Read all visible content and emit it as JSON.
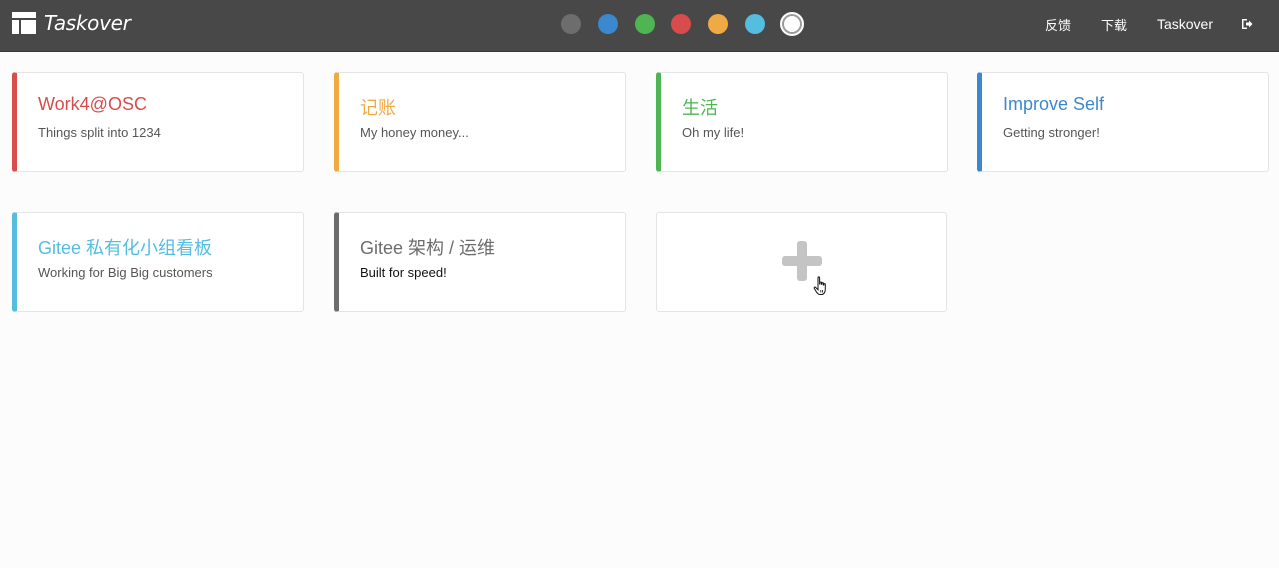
{
  "app": {
    "brand_name": "Taskover",
    "brand_icon": "board-layout-icon"
  },
  "theme_swatches": [
    {
      "name": "gray",
      "color": "#6d6d6d"
    },
    {
      "name": "blue",
      "color": "#3b88ce"
    },
    {
      "name": "green",
      "color": "#4fb552"
    },
    {
      "name": "red",
      "color": "#d84c4c"
    },
    {
      "name": "orange",
      "color": "#f0aa44"
    },
    {
      "name": "cyan",
      "color": "#55bde0"
    },
    {
      "name": "white",
      "color": "#ffffff",
      "active": true
    }
  ],
  "nav": {
    "feedback_label": "反馈",
    "download_label": "下载",
    "user_label": "Taskover",
    "logout_icon": "logout-icon"
  },
  "boards": [
    {
      "title": "Work4@OSC",
      "description": "Things split into 1234",
      "color": "#d84c4c"
    },
    {
      "title": "记账",
      "description": "My honey money...",
      "color": "#f0aa44"
    },
    {
      "title": "生活",
      "description": "Oh my life!",
      "color": "#4fb552"
    },
    {
      "title": "Improve Self",
      "description": "Getting stronger!",
      "color": "#3b88ce"
    },
    {
      "title": "Gitee 私有化小组看板",
      "description": "Working for Big Big customers",
      "color": "#55bde0"
    },
    {
      "title": "Gitee 架构 / 运维",
      "description": "Built for speed!",
      "color": "#6d6d6d"
    }
  ],
  "add_board": {
    "icon": "plus-icon"
  }
}
